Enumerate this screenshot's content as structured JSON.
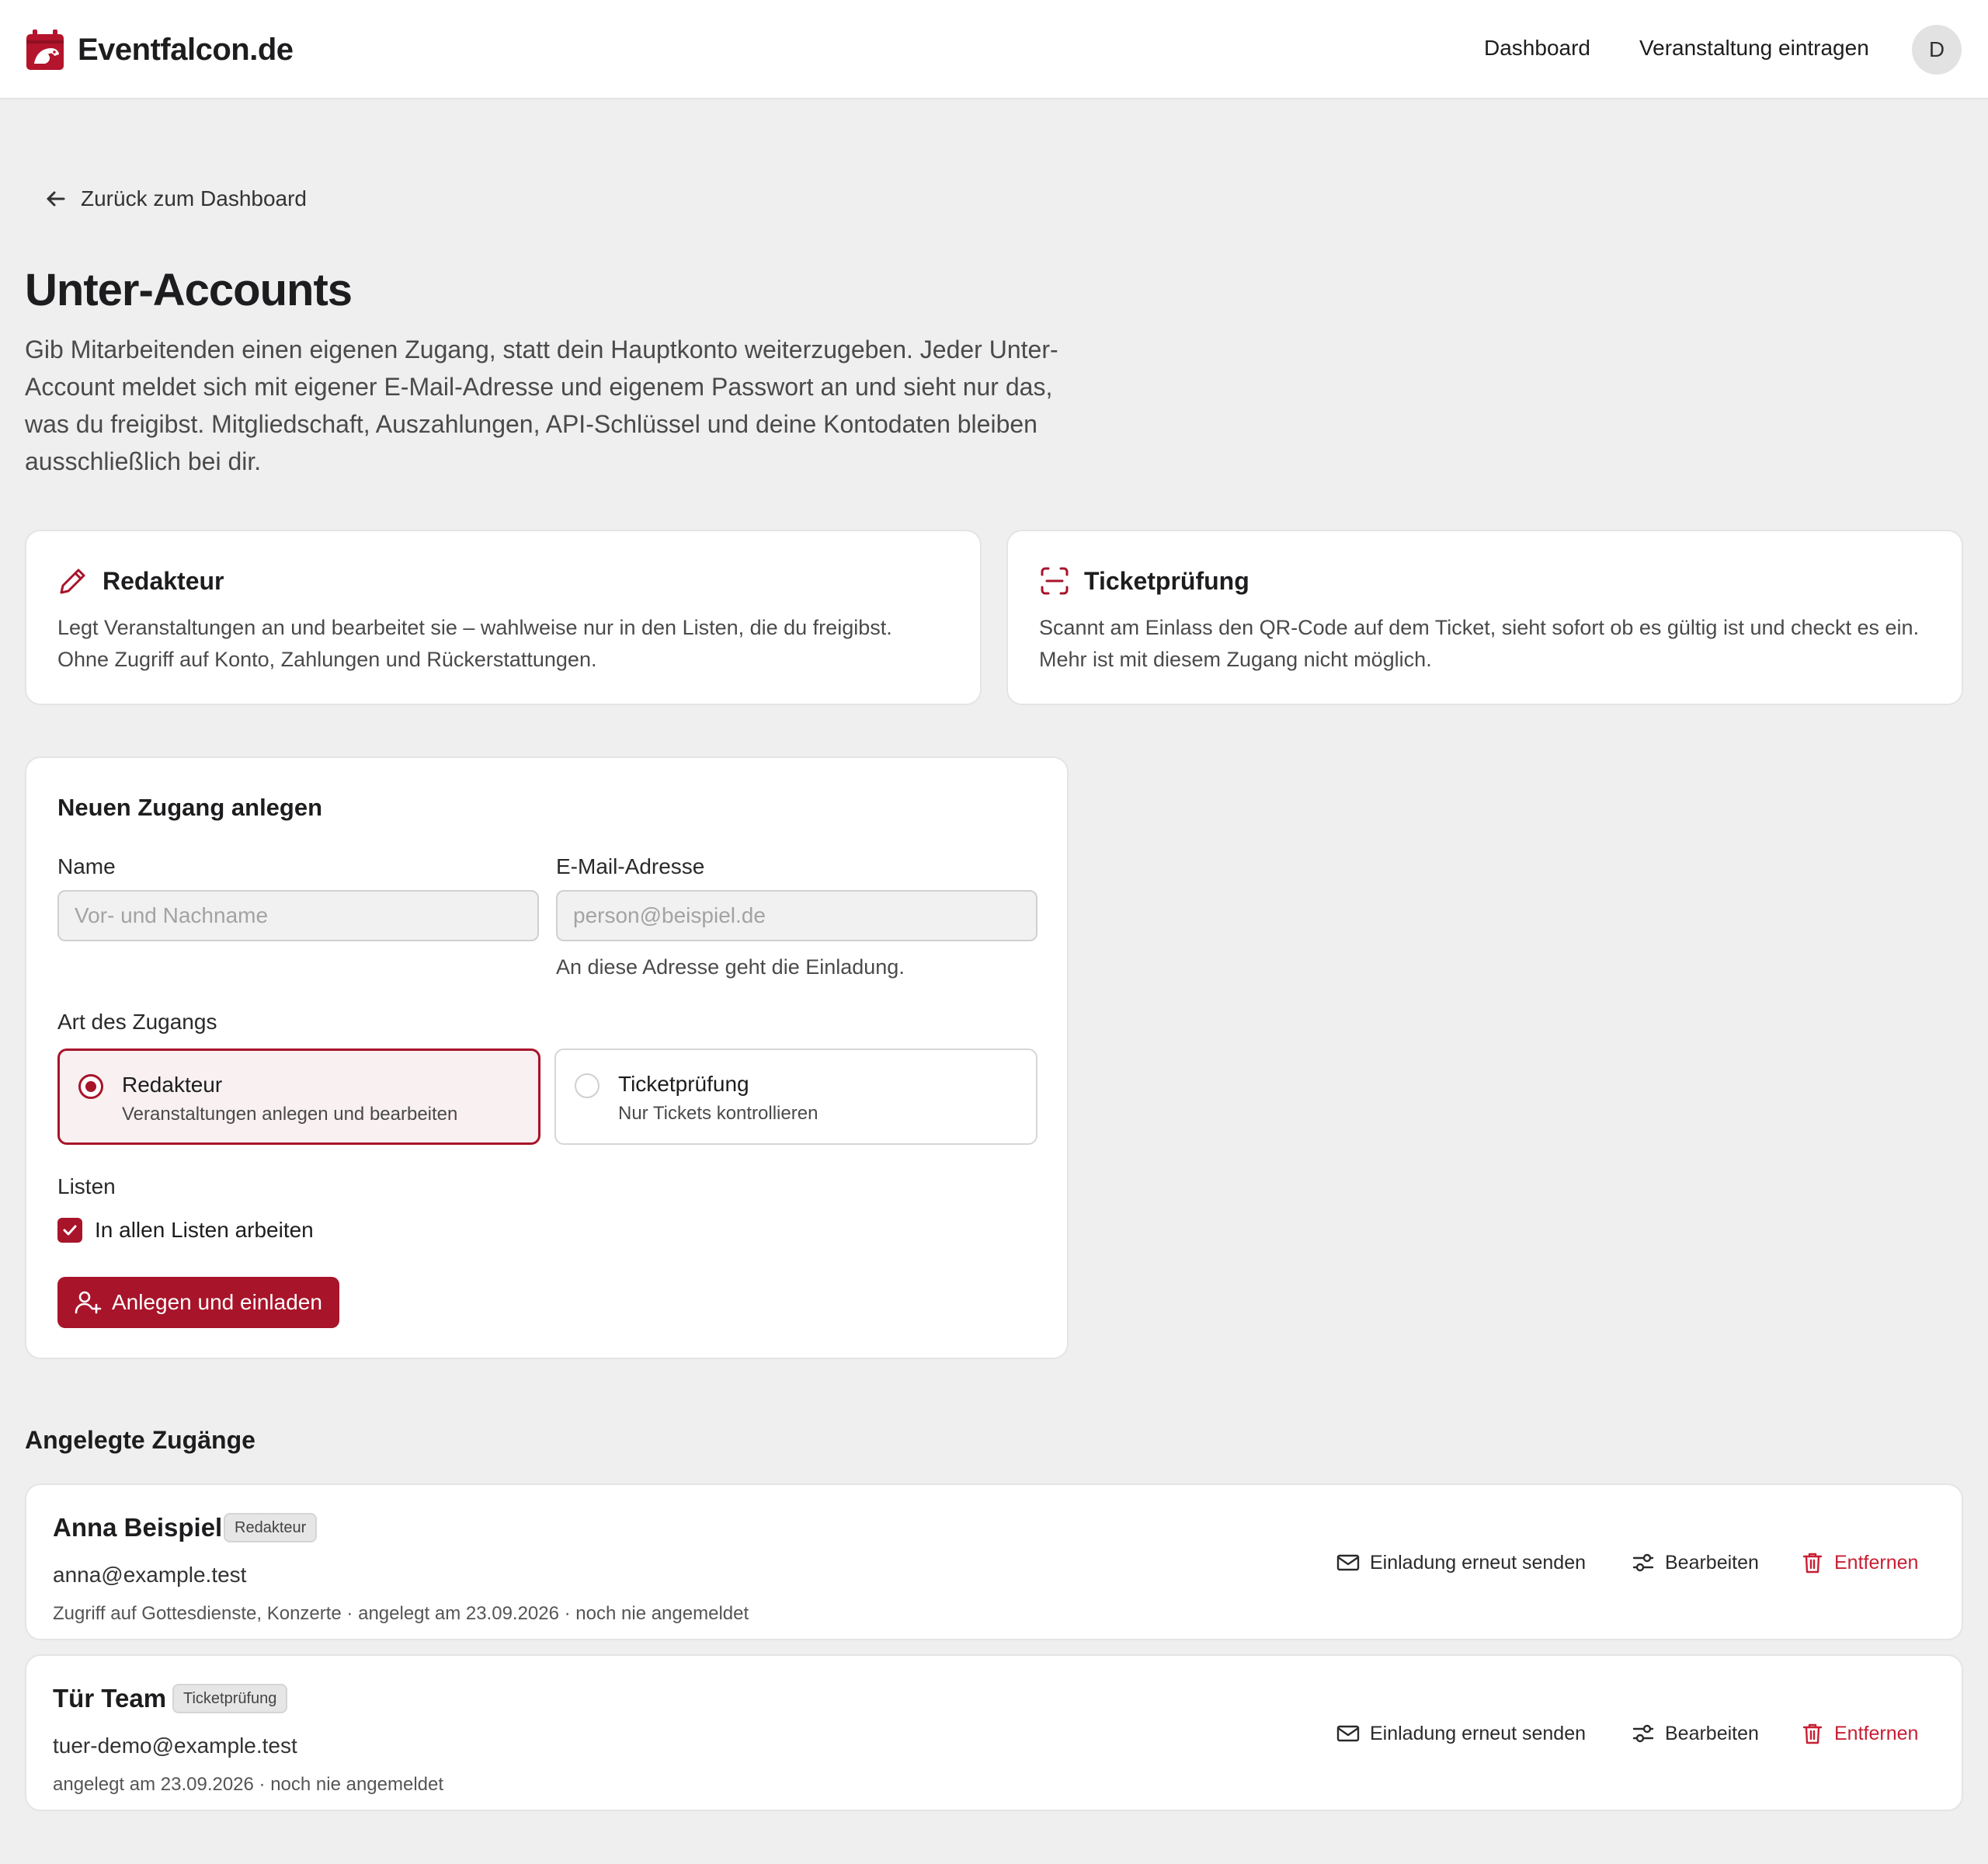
{
  "header": {
    "brand": "Eventfalcon.de",
    "nav": {
      "dashboard": "Dashboard",
      "add_event": "Veranstaltung eintragen"
    },
    "avatar_initial": "D"
  },
  "back_link": "Zurück zum Dashboard",
  "page": {
    "title": "Unter-Accounts",
    "description": "Gib Mitarbeitenden einen eigenen Zugang, statt dein Hauptkonto weiterzugeben. Jeder Unter-Account meldet sich mit eigener E-Mail-Adresse und eigenem Passwort an und sieht nur das, was du freigibst. Mitgliedschaft, Auszahlungen, API-Schlüssel und deine Kontodaten bleiben ausschließlich bei dir."
  },
  "roles": [
    {
      "title": "Redakteur",
      "icon": "pencil-icon",
      "description": "Legt Veranstaltungen an und bearbeitet sie – wahlweise nur in den Listen, die du freigibst. Ohne Zugriff auf Konto, Zahlungen und Rückerstattungen."
    },
    {
      "title": "Ticketprüfung",
      "icon": "scan-icon",
      "description": "Scannt am Einlass den QR-Code auf dem Ticket, sieht sofort ob es gültig ist und checkt es ein. Mehr ist mit diesem Zugang nicht möglich."
    }
  ],
  "form": {
    "title": "Neuen Zugang anlegen",
    "name_label": "Name",
    "name_placeholder": "Vor- und Nachname",
    "name_value": "",
    "email_label": "E-Mail-Adresse",
    "email_placeholder": "person@beispiel.de",
    "email_value": "",
    "email_hint": "An diese Adresse geht die Einladung.",
    "type_label": "Art des Zugangs",
    "types": [
      {
        "title": "Redakteur",
        "subtitle": "Veranstaltungen anlegen und bearbeiten",
        "selected": true
      },
      {
        "title": "Ticketprüfung",
        "subtitle": "Nur Tickets kontrollieren",
        "selected": false
      }
    ],
    "lists_label": "Listen",
    "all_lists_label": "In allen Listen arbeiten",
    "all_lists_checked": true,
    "submit_label": "Anlegen und einladen"
  },
  "accounts_section_title": "Angelegte Zugänge",
  "accounts": [
    {
      "name": "Anna Beispiel",
      "role": "Redakteur",
      "email": "anna@example.test",
      "meta": "Zugriff auf Gottesdienste, Konzerte · angelegt am 23.09.2026 · noch nie angemeldet"
    },
    {
      "name": "Tür Team",
      "role": "Ticketprüfung",
      "email": "tuer-demo@example.test",
      "meta": "angelegt am 23.09.2026 · noch nie angemeldet"
    }
  ],
  "account_actions": {
    "resend": "Einladung erneut senden",
    "edit": "Bearbeiten",
    "remove": "Entfernen"
  },
  "colors": {
    "accent": "#a8142a",
    "danger": "#c81e33",
    "background": "#efefef"
  }
}
